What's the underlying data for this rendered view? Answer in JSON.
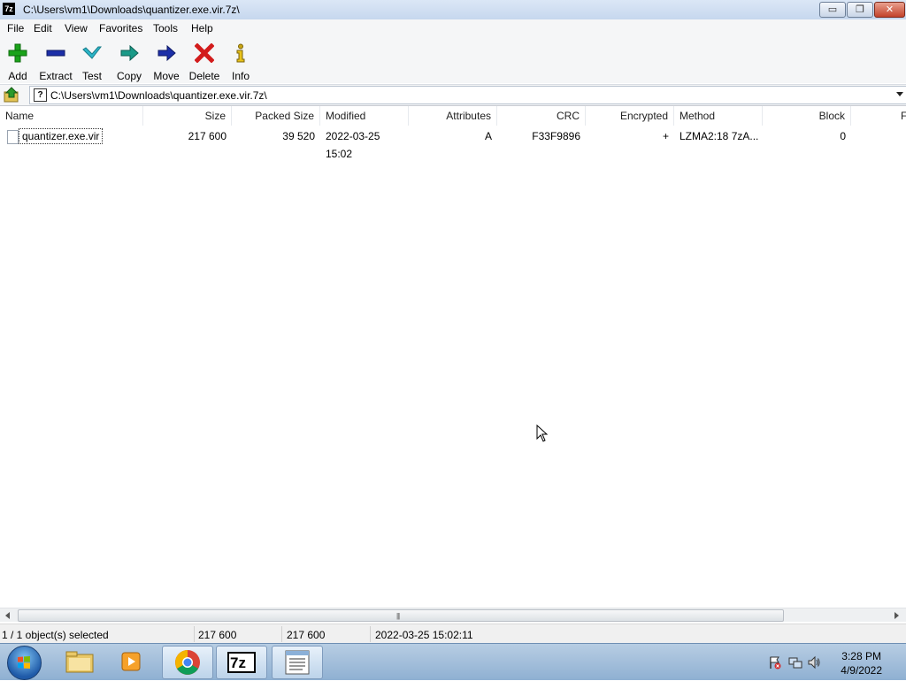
{
  "window": {
    "title": "C:\\Users\\vm1\\Downloads\\quantizer.exe.vir.7z\\",
    "app_icon_text": "7z",
    "min_glyph": "▭",
    "max_glyph": "❐",
    "close_glyph": "✕"
  },
  "menu": [
    "File",
    "Edit",
    "View",
    "Favorites",
    "Tools",
    "Help"
  ],
  "toolbar": [
    {
      "label": "Add",
      "icon": "plus-icon",
      "color": "#1aa31a"
    },
    {
      "label": "Extract",
      "icon": "minus-icon",
      "color": "#1c2fa8"
    },
    {
      "label": "Test",
      "icon": "check-icon",
      "color": "#2bb6c9"
    },
    {
      "label": "Copy",
      "icon": "copy-arrow-icon",
      "color": "#1a9a88"
    },
    {
      "label": "Move",
      "icon": "move-arrow-icon",
      "color": "#1c2fa8"
    },
    {
      "label": "Delete",
      "icon": "delete-x-icon",
      "color": "#d21c1c"
    },
    {
      "label": "Info",
      "icon": "info-icon",
      "color": "#c9a514"
    }
  ],
  "address": {
    "path": "C:\\Users\\vm1\\Downloads\\quantizer.exe.vir.7z\\"
  },
  "columns": [
    {
      "label": "Name",
      "align": "left"
    },
    {
      "label": "Size",
      "align": "right"
    },
    {
      "label": "Packed Size",
      "align": "right"
    },
    {
      "label": "Modified",
      "align": "left"
    },
    {
      "label": "Attributes",
      "align": "right"
    },
    {
      "label": "CRC",
      "align": "right"
    },
    {
      "label": "Encrypted",
      "align": "right"
    },
    {
      "label": "Method",
      "align": "left"
    },
    {
      "label": "Block",
      "align": "right"
    },
    {
      "label": "F",
      "align": "left"
    }
  ],
  "rows": [
    {
      "name": "quantizer.exe.vir",
      "size": "217 600",
      "packed_size": "39 520",
      "modified": "2022-03-25 15:02",
      "attributes": "A",
      "crc": "F33F9896",
      "encrypted": "+",
      "method": "LZMA2:18 7zA...",
      "block": "0"
    }
  ],
  "scrollbar": {
    "grip": "|||"
  },
  "status": {
    "selection": "1 / 1 object(s) selected",
    "size": "217 600",
    "packed": "217 600",
    "modified": "2022-03-25 15:02:11"
  },
  "taskbar": {
    "time": "3:28 PM",
    "date": "4/9/2022",
    "seven_zip_text": "7z"
  }
}
